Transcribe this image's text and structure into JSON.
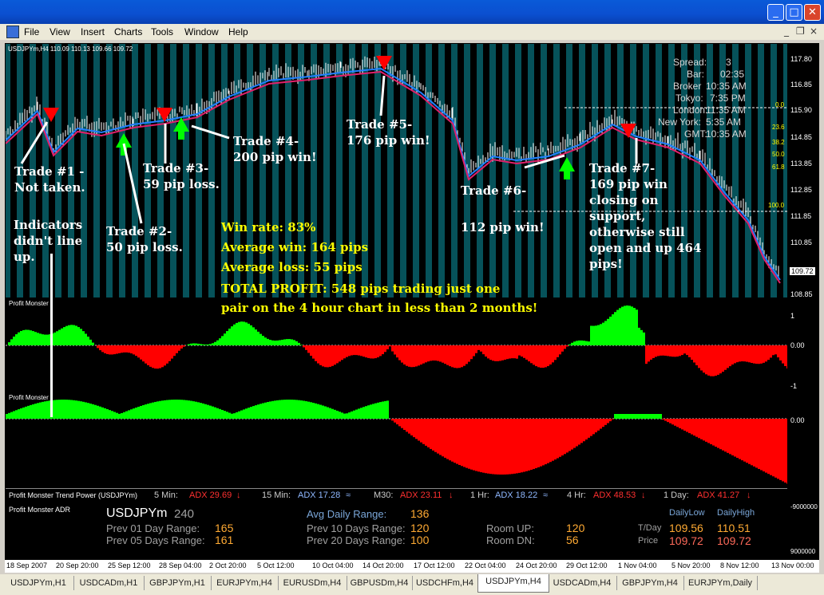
{
  "menu": [
    "File",
    "View",
    "Insert",
    "Charts",
    "Tools",
    "Window",
    "Help"
  ],
  "chart": {
    "header": "USDJPYm,H4  110.09 110.13 109.66 109.72",
    "price_ticks": [
      "117.80",
      "116.85",
      "115.90",
      "114.85",
      "113.85",
      "112.85",
      "111.85",
      "110.85",
      "108.85"
    ],
    "current_price": "109.72",
    "info": {
      "spread_label": "Spread:",
      "spread_value": "3",
      "bar_label": "Bar:",
      "bar_value": "02:35",
      "broker_label": "Broker",
      "broker_value": "10:35 AM",
      "tokyo_label": "Tokyo:",
      "tokyo_value": "7:35 PM",
      "london_label": "London:",
      "london_value": "11:35 AM",
      "newyork_label": "New York:",
      "newyork_value": "5:35 AM",
      "gmt_label": "GMT:",
      "gmt_value": "10:35 AM"
    },
    "fib_levels": [
      "0.0",
      "23.6",
      "38.2",
      "50.0",
      "61.8",
      "100.0"
    ],
    "annotations": {
      "trade1": [
        "Trade #1 -",
        "Not taken."
      ],
      "trade2": [
        "Trade #2-",
        "50 pip loss."
      ],
      "trade3": [
        "Trade #3-",
        "59 pip loss."
      ],
      "trade4": [
        "Trade #4-",
        "200 pip win!"
      ],
      "trade5": [
        "Trade #5-",
        "176 pip win!"
      ],
      "trade6": [
        "Trade #6-",
        "112 pip win!"
      ],
      "trade7": [
        "Trade #7-",
        "169 pip win",
        "closing on",
        "support,",
        "otherwise still",
        "open and up 464",
        "pips!"
      ],
      "indicators": [
        "Indicators",
        "didn't line",
        "up."
      ]
    },
    "stats": {
      "win_rate": "Win rate: 83%",
      "avg_win": "Average win: 164 pips",
      "avg_loss": "Average loss:  55 pips",
      "total": "TOTAL PROFIT:  548 pips trading just one",
      "total2": "pair on the 4 hour chart in less than 2 months!"
    }
  },
  "indicator1": {
    "label": "Profit Monster",
    "ticks": [
      "1",
      "0.00",
      "-1"
    ]
  },
  "indicator2": {
    "label": "Profit Monster",
    "ticks": [
      "0.00"
    ]
  },
  "trend_power": {
    "label": "Profit Monster Trend Power (USDJPYm)",
    "items": [
      {
        "tf": "5 Min:",
        "adx": "ADX 29.69",
        "dir": "↓",
        "color": "#ff3030"
      },
      {
        "tf": "15 Min:",
        "adx": "ADX 17.28",
        "dir": "≈",
        "color": "#8fb8ff"
      },
      {
        "tf": "M30:",
        "adx": "ADX 23.11",
        "dir": "↓",
        "color": "#ff3030"
      },
      {
        "tf": "1 Hr:",
        "adx": "ADX 18.22",
        "dir": "≈",
        "color": "#8fb8ff"
      },
      {
        "tf": "4 Hr:",
        "adx": "ADX 48.53",
        "dir": "↓",
        "color": "#ff3030"
      },
      {
        "tf": "1 Day:",
        "adx": "ADX 41.27",
        "dir": "↓",
        "color": "#ff3030"
      }
    ]
  },
  "adr": {
    "label": "Profit Monster ADR",
    "symbol": "USDJPYm",
    "period": "240",
    "prev01_label": "Prev 01 Day Range:",
    "prev01": "165",
    "prev05_label": "Prev 05 Days Range:",
    "prev05": "161",
    "avg_label": "Avg Daily Range:",
    "avg": "136",
    "prev10_label": "Prev 10 Days Range:",
    "prev10": "120",
    "prev20_label": "Prev 20 Days Range:",
    "prev20": "100",
    "roomup_label": "Room UP:",
    "roomup": "120",
    "roomdn_label": "Room DN:",
    "roomdn": "56",
    "daily_low_label": "DailyLow",
    "daily_high_label": "DailyHigh",
    "tday_label": "T/Day",
    "tday_low": "109.56",
    "tday_high": "110.51",
    "price_label": "Price",
    "price_low": "109.72",
    "price_high": "109.72",
    "axis_top": "-9000000",
    "axis_bottom": "9000000"
  },
  "time_axis": [
    "18 Sep 2007",
    "20 Sep 20:00",
    "25 Sep 12:00",
    "28 Sep 04:00",
    "2 Oct 20:00",
    "5 Oct 12:00",
    "10 Oct 04:00",
    "14 Oct 20:00",
    "17 Oct 12:00",
    "22 Oct 04:00",
    "24 Oct 20:00",
    "29 Oct 12:00",
    "1 Nov 04:00",
    "5 Nov 20:00",
    "8 Nov 12:00",
    "13 Nov 00:00"
  ],
  "tabs": [
    "USDJPYm,H1",
    "USDCADm,H1",
    "GBPJPYm,H1",
    "EURJPYm,H4",
    "EURUSDm,H4",
    "GBPUSDm,H4",
    "USDCHFm,H4",
    "USDJPYm,H4",
    "USDCADm,H4",
    "GBPJPYm,H4",
    "EURJPYm,Daily"
  ],
  "active_tab": "USDJPYm,H4",
  "colors": {
    "chart_bg": "#06525a",
    "bull": "#00ff00",
    "bear": "#ff0000",
    "annotation": "#ffffff",
    "highlight": "#ffff00"
  }
}
